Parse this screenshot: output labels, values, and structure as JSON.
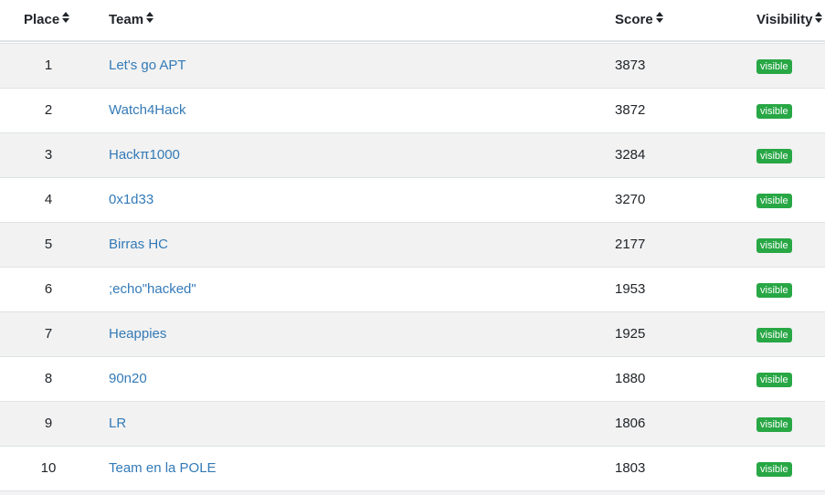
{
  "table": {
    "headers": {
      "place": "Place",
      "team": "Team",
      "score": "Score",
      "visibility": "Visibility"
    },
    "sort_icon": "sort-icon",
    "rows": [
      {
        "place": "1",
        "team": "Let's go APT",
        "score": "3873",
        "visibility": "visible"
      },
      {
        "place": "2",
        "team": "Watch4Hack",
        "score": "3872",
        "visibility": "visible"
      },
      {
        "place": "3",
        "team": "Hackπ1000",
        "score": "3284",
        "visibility": "visible"
      },
      {
        "place": "4",
        "team": "0x1d33",
        "score": "3270",
        "visibility": "visible"
      },
      {
        "place": "5",
        "team": "Birras HC",
        "score": "2177",
        "visibility": "visible"
      },
      {
        "place": "6",
        "team": ";echo\"hacked\"",
        "score": "1953",
        "visibility": "visible"
      },
      {
        "place": "7",
        "team": "Heappies",
        "score": "1925",
        "visibility": "visible"
      },
      {
        "place": "8",
        "team": "90n20",
        "score": "1880",
        "visibility": "visible"
      },
      {
        "place": "9",
        "team": "LR",
        "score": "1806",
        "visibility": "visible"
      },
      {
        "place": "10",
        "team": "Team en la POLE",
        "score": "1803",
        "visibility": "visible"
      }
    ]
  },
  "colors": {
    "link": "#337ab7",
    "badge": "#28a745",
    "stripe": "#f2f2f2",
    "border": "#dee2e6"
  }
}
